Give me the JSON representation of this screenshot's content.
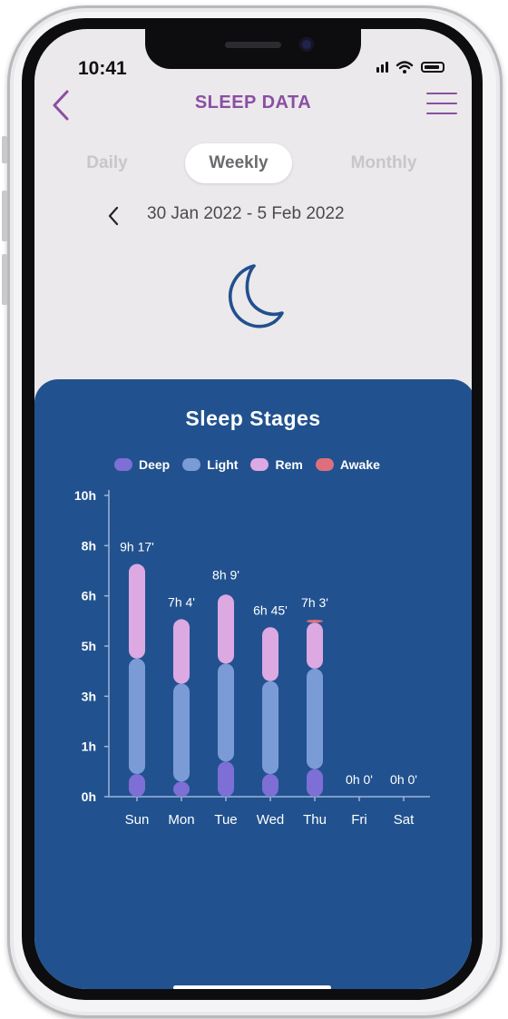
{
  "status": {
    "time": "10:41"
  },
  "header": {
    "title": "SLEEP DATA"
  },
  "tabs": [
    {
      "label": "Daily",
      "active": false
    },
    {
      "label": "Weekly",
      "active": true
    },
    {
      "label": "Monthly",
      "active": false
    }
  ],
  "date_range": "30 Jan 2022 - 5 Feb 2022",
  "colors": {
    "accent": "#8a4fa3",
    "panel": "#21528f",
    "moon": "#22508e",
    "deep": "#7d6fd6",
    "light": "#7b9bd6",
    "rem": "#dca9e2",
    "awake": "#df6f7d"
  },
  "chart_data": {
    "type": "bar",
    "title": "Sleep Stages",
    "stacked": true,
    "categories": [
      "Sun",
      "Mon",
      "Tue",
      "Wed",
      "Thu",
      "Fri",
      "Sat"
    ],
    "series": [
      {
        "name": "Deep",
        "values": [
          0.9,
          0.6,
          1.4,
          0.9,
          1.1,
          0,
          0
        ]
      },
      {
        "name": "Light",
        "values": [
          4.6,
          3.9,
          3.9,
          3.7,
          4.0,
          0,
          0
        ]
      },
      {
        "name": "Rem",
        "values": [
          3.77,
          2.57,
          2.75,
          2.15,
          1.83,
          0,
          0
        ]
      },
      {
        "name": "Awake",
        "values": [
          0,
          0,
          0,
          0,
          0.12,
          0,
          0
        ]
      }
    ],
    "totals": [
      9.28,
      7.07,
      8.15,
      6.75,
      7.05,
      0,
      0
    ],
    "total_labels": [
      "9h 17'",
      "7h 4'",
      "8h 9'",
      "6h 45'",
      "7h 3'",
      "0h 0'",
      "0h 0'"
    ],
    "y_tick_values": [
      0,
      2,
      4,
      6,
      8,
      10
    ],
    "y_tick_labels": [
      "0h",
      "1h",
      "3h",
      "5h",
      "6h",
      "8h",
      "10h"
    ],
    "ylim": [
      0,
      12
    ],
    "legend_position": "top",
    "grid": false
  }
}
